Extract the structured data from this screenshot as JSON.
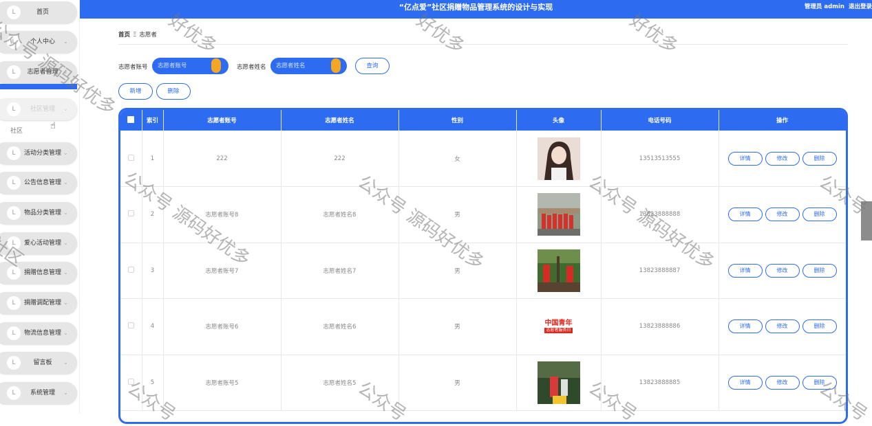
{
  "header": {
    "title": "“亿点爱”社区捐赠物品管理系统的设计与实现",
    "user_label": "管理员 admin",
    "logout": "退出登录"
  },
  "sidebar": {
    "items": [
      {
        "label": "首页",
        "has_chevron": false
      },
      {
        "label": "个人中心",
        "has_chevron": true
      },
      {
        "label": "志愿者管理",
        "has_chevron": true
      },
      {
        "label": "社区管理",
        "has_chevron": true,
        "faded": true
      },
      {
        "label": "活动分类管理",
        "has_chevron": true
      },
      {
        "label": "公告信息管理",
        "has_chevron": true
      },
      {
        "label": "物品分类管理",
        "has_chevron": true
      },
      {
        "label": "爱心活动管理",
        "has_chevron": true
      },
      {
        "label": "捐赠信息管理",
        "has_chevron": true
      },
      {
        "label": "捐赠调配管理",
        "has_chevron": true
      },
      {
        "label": "物流信息管理",
        "has_chevron": true
      },
      {
        "label": "留言板",
        "has_chevron": true
      },
      {
        "label": "系统管理",
        "has_chevron": true
      }
    ],
    "submenu_label": "社区",
    "icon_glyph": "L",
    "chevron_glyph": "⌄"
  },
  "breadcrumb": {
    "home": "首页",
    "separator": "Ξ",
    "current": "志愿者"
  },
  "search": {
    "account_label": "志愿者账号",
    "account_placeholder": "志愿者账号",
    "name_label": "志愿者姓名",
    "name_placeholder": "志愿者姓名",
    "query_button": "查询"
  },
  "actions": {
    "add": "新增",
    "delete": "删除"
  },
  "table": {
    "columns": [
      "索引",
      "志愿者账号",
      "志愿者姓名",
      "性别",
      "头像",
      "电话号码",
      "操作"
    ],
    "rows": [
      {
        "index": "1",
        "account": "222",
        "name": "222",
        "gender": "女",
        "phone": "13513513555"
      },
      {
        "index": "2",
        "account": "志愿者账号8",
        "name": "志愿者姓名8",
        "gender": "男",
        "phone": "13823888888"
      },
      {
        "index": "3",
        "account": "志愿者账号7",
        "name": "志愿者姓名7",
        "gender": "男",
        "phone": "13823888887"
      },
      {
        "index": "4",
        "account": "志愿者账号6",
        "name": "志愿者姓名6",
        "gender": "男",
        "phone": "13823888886",
        "avatar_text": [
          "中国青年",
          "志愿者服务日"
        ]
      },
      {
        "index": "5",
        "account": "志愿者账号5",
        "name": "志愿者姓名5",
        "gender": "男",
        "phone": "13823888885"
      }
    ],
    "row_actions": {
      "detail": "详情",
      "edit": "修改",
      "delete": "删除"
    }
  },
  "watermark": {
    "text_full": "公众号 源码好优多",
    "text_short_1": "公众号",
    "text_short_2": "源码好优多",
    "text_mid": "社区",
    "text_tail": "好优多"
  },
  "colors": {
    "primary": "#2d6cf0",
    "accent": "#f5a623"
  }
}
